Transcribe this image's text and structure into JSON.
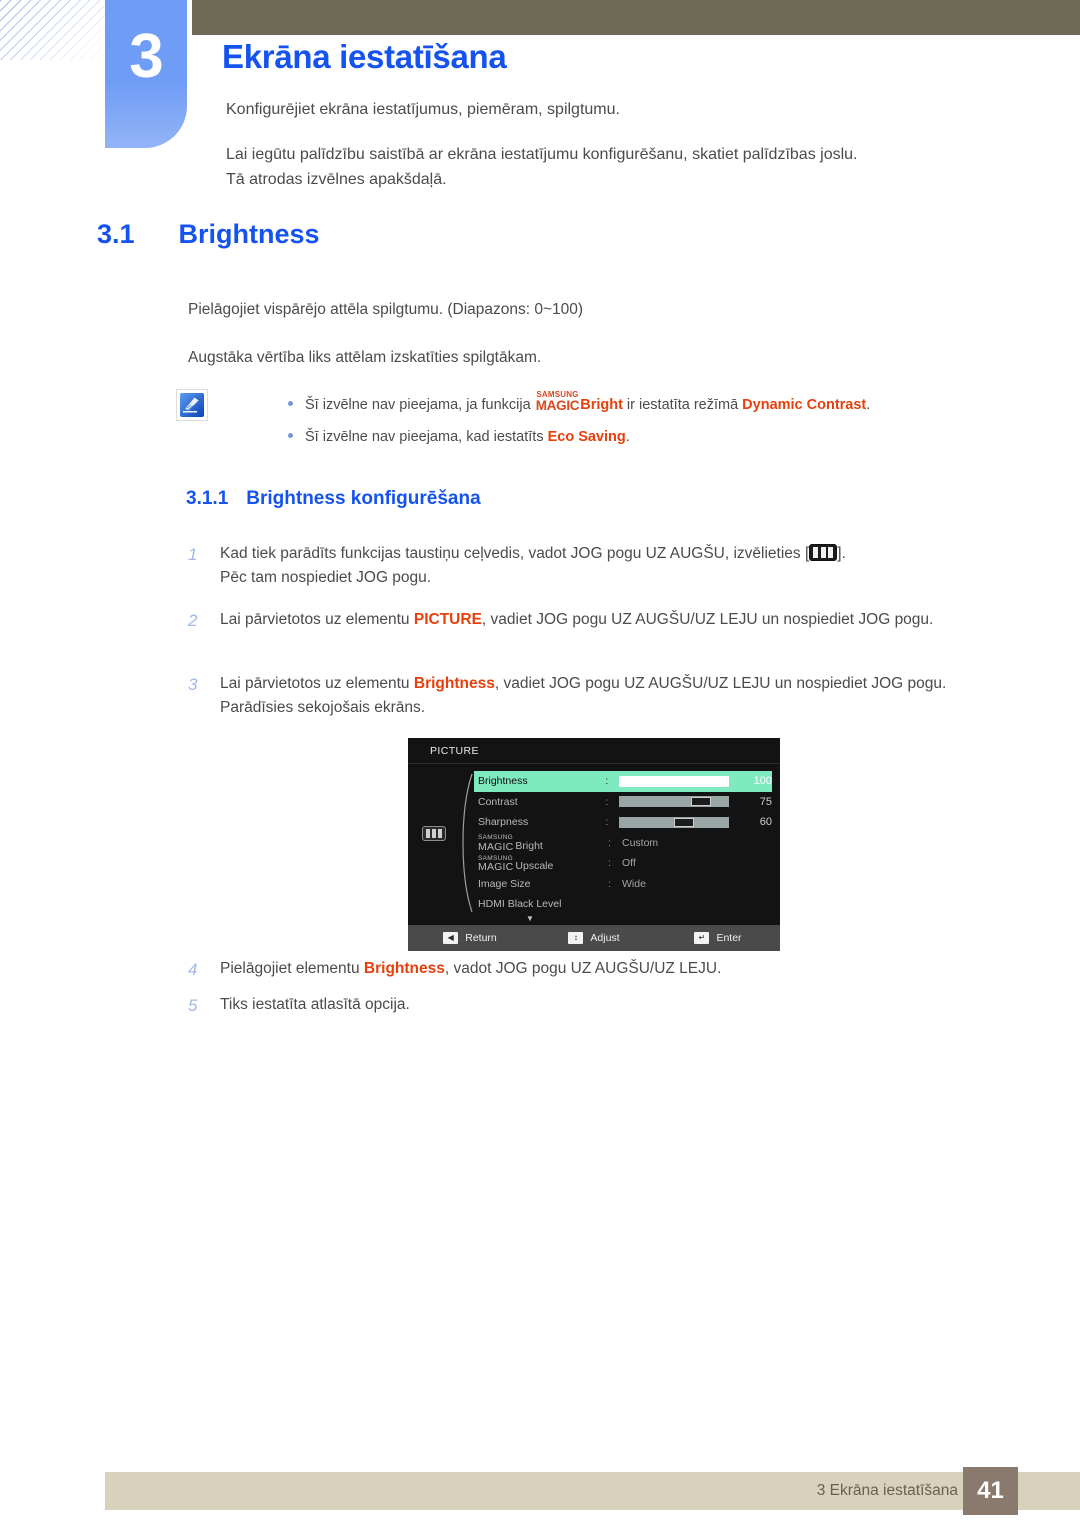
{
  "header": {
    "chapter_number": "3",
    "chapter_title": "Ekrāna iestatīšana",
    "intro_line_1": "Konfigurējiet ekrāna iestatījumus, piemēram, spilgtumu.",
    "intro_line_2": "Lai iegūtu palīdzību saistībā ar ekrāna iestatījumu konfigurēšanu, skatiet palīdzības joslu.",
    "intro_line_3": "Tā atrodas izvēlnes apakšdaļā.",
    "accent_color": "#1453f0",
    "badge_color": "#6f9cf5",
    "bar_color": "#6d6a55"
  },
  "section": {
    "number": "3.1",
    "title": "Brightness",
    "paragraph_range": "Pielāgojiet vispārējo attēla spilgtumu. (Diapazons: 0~100)",
    "paragraph_higher": "Augstāka vērtība liks attēlam izskatīties spilgtākam."
  },
  "note": {
    "icon": "note-pencil-icon",
    "items": [
      {
        "prefix": "Šī izvēlne nav pieejama, ja funkcija ",
        "logo_top": "SAMSUNG",
        "logo_bottom": "MAGIC",
        "logo_suffix": "Bright",
        "middle": " ir iestatīta režīmā ",
        "highlight": "Dynamic Contrast",
        "suffix": "."
      },
      {
        "prefix": "Šī izvēlne nav pieejama, kad iestatīts ",
        "highlight": "Eco Saving",
        "suffix": "."
      }
    ]
  },
  "subsection": {
    "number": "3.1.1",
    "title": "Brightness konfigurēšana",
    "steps": [
      {
        "num": "1",
        "text_before": "Kad tiek parādīts funkcijas taustiņu ceļvedis, vadot JOG pogu UZ AUGŠU, izvēlieties [",
        "icon": "picture-mode-icon",
        "text_after": "].",
        "line2": "Pēc tam nospiediet JOG pogu."
      },
      {
        "num": "2",
        "text_before": "Lai pārvietotos uz elementu ",
        "highlight": "PICTURE",
        "text_after": ", vadiet JOG pogu UZ AUGŠU/UZ LEJU un nospiediet JOG pogu."
      },
      {
        "num": "3",
        "text_before": "Lai pārvietotos uz elementu ",
        "highlight": "Brightness",
        "text_after": ", vadiet JOG pogu UZ AUGŠU/UZ LEJU un nospiediet JOG pogu. Parādīsies sekojošais ekrāns."
      },
      {
        "num": "4",
        "text_before": "Pielāgojiet elementu ",
        "highlight": "Brightness",
        "text_after": ", vadot JOG pogu UZ AUGŠU/UZ LEJU."
      },
      {
        "num": "5",
        "text_before": "Tiks iestatīta atlasītā opcija.",
        "highlight": "",
        "text_after": ""
      }
    ]
  },
  "osd": {
    "title": "PICTURE",
    "side_icon": "picture-mode-icon",
    "rows": [
      {
        "label": "Brightness",
        "colon": ":",
        "type": "slider",
        "value": "100",
        "percent": 100,
        "selected": true
      },
      {
        "label": "Contrast",
        "colon": ":",
        "type": "slider",
        "value": "75",
        "percent": 75,
        "selected": false
      },
      {
        "label": "Sharpness",
        "colon": ":",
        "type": "slider",
        "value": "60",
        "percent": 60,
        "selected": false
      },
      {
        "label_logo_top": "SAMSUNG",
        "label_logo_bottom": "MAGIC",
        "label": "Bright",
        "colon": ":",
        "type": "value",
        "value": "Custom",
        "selected": false
      },
      {
        "label_logo_top": "SAMSUNG",
        "label_logo_bottom": "MAGIC",
        "label": "Upscale",
        "colon": ":",
        "type": "value",
        "value": "Off",
        "selected": false
      },
      {
        "label": "Image Size",
        "colon": ":",
        "type": "value",
        "value": "Wide",
        "selected": false
      },
      {
        "label": "HDMI Black Level",
        "colon": "",
        "type": "value",
        "value": "",
        "selected": false
      }
    ],
    "scroll_down_arrow": "▼",
    "footer": [
      {
        "key": "◀",
        "label": "Return"
      },
      {
        "key": "↕",
        "label": "Adjust"
      },
      {
        "key": "↵",
        "label": "Enter"
      }
    ],
    "highlight_color": "#7fe9c0",
    "background_color": "#131313"
  },
  "footer": {
    "text": "3 Ekrāna iestatīšana",
    "page_number": "41",
    "bar_color": "#d8d1bc",
    "page_box_color": "#8a7a6d"
  }
}
